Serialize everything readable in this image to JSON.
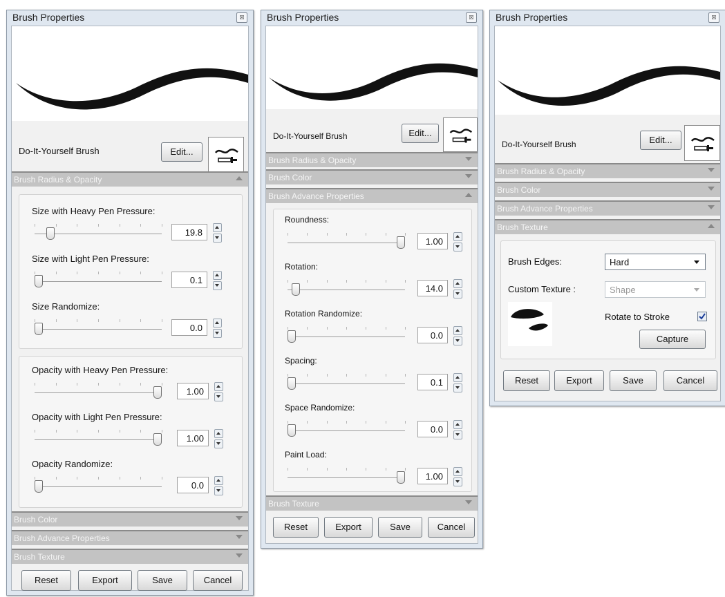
{
  "panel_title": "Brush Properties",
  "brush_name": "Do-It-Yourself Brush",
  "edit_label": "Edit...",
  "sections": {
    "radius_opacity": "Brush Radius & Opacity",
    "color": "Brush Color",
    "advance": "Brush Advance Properties",
    "texture": "Brush Texture"
  },
  "buttons": {
    "reset": "Reset",
    "export": "Export",
    "save": "Save",
    "cancel": "Cancel"
  },
  "panel1": {
    "size_sliders": [
      {
        "label": "Size with Heavy Pen Pressure:",
        "value": "19.8",
        "level": 0.1
      },
      {
        "label": "Size with Light Pen Pressure:",
        "value": "0.1",
        "level": 0.0
      },
      {
        "label": "Size Randomize:",
        "value": "0.0",
        "level": 0.0
      }
    ],
    "opacity_sliders": [
      {
        "label": "Opacity with Heavy Pen Pressure:",
        "value": "1.00",
        "level": 1.0
      },
      {
        "label": "Opacity with Light Pen Pressure:",
        "value": "1.00",
        "level": 1.0
      },
      {
        "label": "Opacity Randomize:",
        "value": "0.0",
        "level": 0.0
      }
    ]
  },
  "panel2": {
    "sliders": [
      {
        "label": "Roundness:",
        "value": "1.00",
        "level": 1.0
      },
      {
        "label": "Rotation:",
        "value": "14.0",
        "level": 0.04
      },
      {
        "label": "Rotation Randomize:",
        "value": "0.0",
        "level": 0.0
      },
      {
        "label": "Spacing:",
        "value": "0.1",
        "level": 0.0
      },
      {
        "label": "Space Randomize:",
        "value": "0.0",
        "level": 0.0
      },
      {
        "label": "Paint Load:",
        "value": "1.00",
        "level": 1.0
      }
    ]
  },
  "panel3": {
    "brush_edges_label": "Brush Edges:",
    "brush_edges_value": "Hard",
    "custom_texture_label": "Custom Texture :",
    "custom_texture_value": "Shape",
    "rotate_label": "Rotate to Stroke",
    "rotate_checked": true,
    "capture_label": "Capture"
  }
}
